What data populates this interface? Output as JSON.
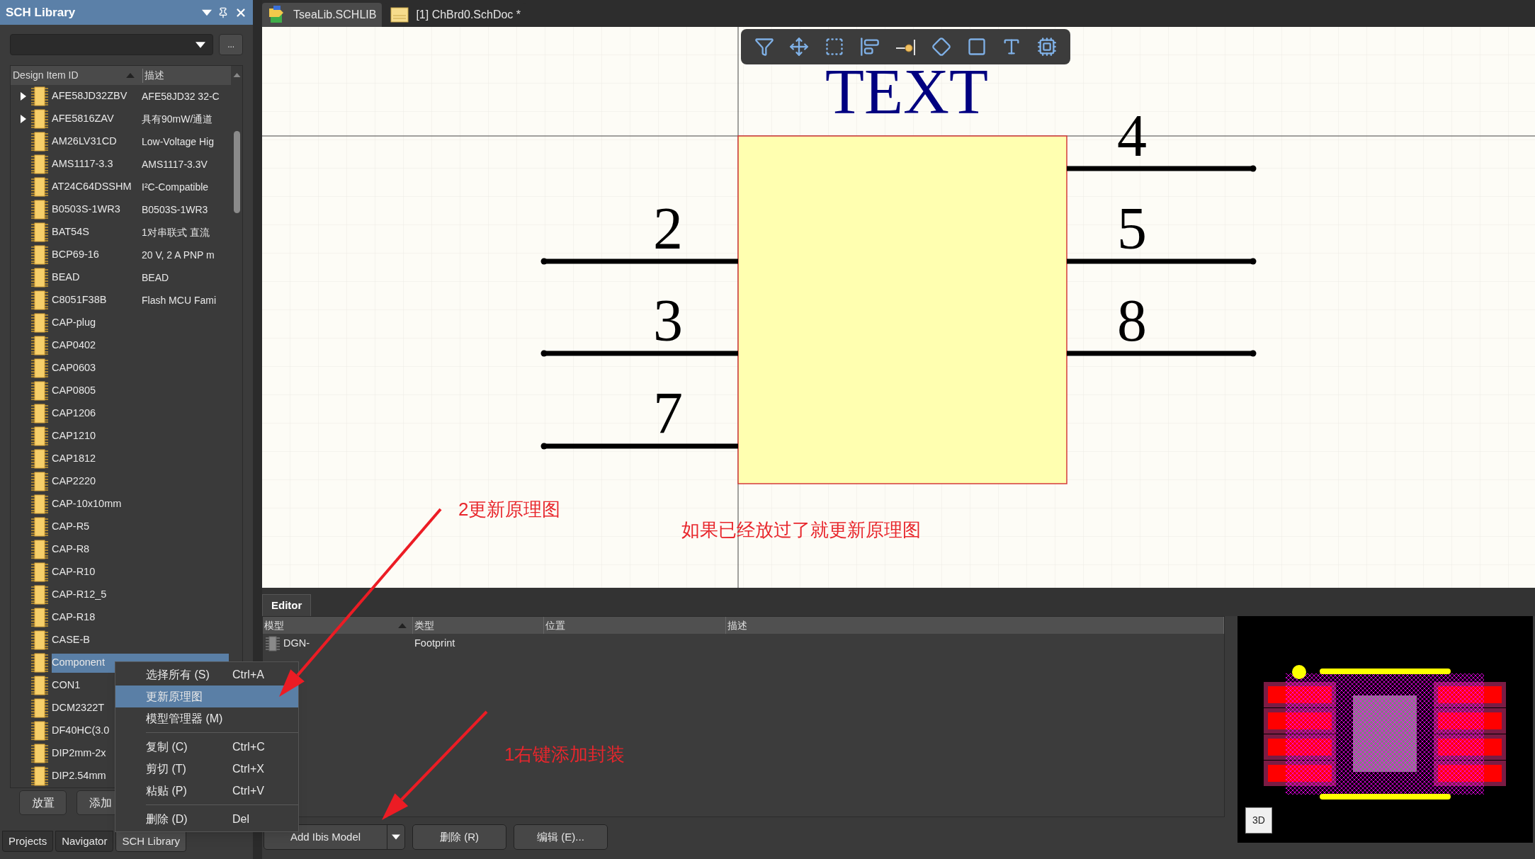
{
  "sidebar": {
    "title": "SCH Library",
    "browse_button": "...",
    "columns": [
      "Design Item ID",
      "描述"
    ],
    "items": [
      {
        "id": "AFE58JD32ZBV",
        "description": "AFE58JD32 32-C",
        "expandable": true,
        "selected": false
      },
      {
        "id": "AFE5816ZAV",
        "description": "具有90mW/通道",
        "expandable": true,
        "selected": false
      },
      {
        "id": "AM26LV31CD",
        "description": "Low-Voltage Hig",
        "expandable": false,
        "selected": false
      },
      {
        "id": "AMS1117-3.3",
        "description": "AMS1117-3.3V",
        "expandable": false,
        "selected": false
      },
      {
        "id": "AT24C64DSSHM",
        "description": "I²C-Compatible",
        "expandable": false,
        "selected": false
      },
      {
        "id": "B0503S-1WR3",
        "description": "B0503S-1WR3",
        "expandable": false,
        "selected": false
      },
      {
        "id": "BAT54S",
        "description": "1对串联式 直流",
        "expandable": false,
        "selected": false
      },
      {
        "id": "BCP69-16",
        "description": "20 V, 2 A PNP m",
        "expandable": false,
        "selected": false
      },
      {
        "id": "BEAD",
        "description": "BEAD",
        "expandable": false,
        "selected": false
      },
      {
        "id": "C8051F38B",
        "description": "Flash MCU Fami",
        "expandable": false,
        "selected": false
      },
      {
        "id": "CAP-plug",
        "expandable": false,
        "selected": false
      },
      {
        "id": "CAP0402",
        "expandable": false,
        "selected": false
      },
      {
        "id": "CAP0603",
        "expandable": false,
        "selected": false
      },
      {
        "id": "CAP0805",
        "expandable": false,
        "selected": false
      },
      {
        "id": "CAP1206",
        "expandable": false,
        "selected": false
      },
      {
        "id": "CAP1210",
        "expandable": false,
        "selected": false
      },
      {
        "id": "CAP1812",
        "expandable": false,
        "selected": false
      },
      {
        "id": "CAP2220",
        "expandable": false,
        "selected": false
      },
      {
        "id": "CAP-10x10mm",
        "expandable": false,
        "selected": false
      },
      {
        "id": "CAP-R5",
        "expandable": false,
        "selected": false
      },
      {
        "id": "CAP-R8",
        "expandable": false,
        "selected": false
      },
      {
        "id": "CAP-R10",
        "expandable": false,
        "selected": false
      },
      {
        "id": "CAP-R12_5",
        "expandable": false,
        "selected": false
      },
      {
        "id": "CAP-R18",
        "expandable": false,
        "selected": false
      },
      {
        "id": "CASE-B",
        "expandable": false,
        "selected": false
      },
      {
        "id": "Component",
        "expandable": false,
        "selected": true
      },
      {
        "id": "CON1",
        "expandable": false,
        "selected": false
      },
      {
        "id": "DCM2322T",
        "expandable": false,
        "selected": false
      },
      {
        "id": "DF40HC(3.0",
        "expandable": false,
        "selected": false
      },
      {
        "id": "DIP2mm-2x",
        "expandable": false,
        "selected": false
      },
      {
        "id": "DIP2.54mm",
        "expandable": false,
        "selected": false
      }
    ],
    "buttons": [
      "放置",
      "添加"
    ]
  },
  "panel_tabs": [
    {
      "label": "Projects",
      "selected": false
    },
    {
      "label": "Navigator",
      "selected": false
    },
    {
      "label": "SCH Library",
      "selected": true
    }
  ],
  "doc_tabs": [
    {
      "label": "TseaLib.SCHLIB",
      "kind": "library",
      "selected": true
    },
    {
      "label": "[1] ChBrd0.SchDoc *",
      "kind": "schematic",
      "selected": false
    }
  ],
  "canvas": {
    "title_text": "TEXT",
    "left_pins": [
      {
        "number": "2"
      },
      {
        "number": "3"
      },
      {
        "number": "7"
      }
    ],
    "right_pins": [
      {
        "number": "4"
      },
      {
        "number": "5"
      },
      {
        "number": "8"
      }
    ],
    "callout": "2更新原理图",
    "note": "如果已经放过了就更新原理图"
  },
  "context_menu": {
    "items": [
      {
        "kind": "item",
        "label": "选择所有 (S)",
        "shortcut": "Ctrl+A",
        "selected": false
      },
      {
        "kind": "item",
        "label": "更新原理图",
        "selected": true
      },
      {
        "kind": "item",
        "label": "模型管理器 (M)",
        "selected": false
      },
      {
        "kind": "separator"
      },
      {
        "kind": "item",
        "label": "复制 (C)",
        "shortcut": "Ctrl+C",
        "selected": false
      },
      {
        "kind": "item",
        "label": "剪切 (T)",
        "shortcut": "Ctrl+X",
        "selected": false
      },
      {
        "kind": "item",
        "label": "粘贴 (P)",
        "shortcut": "Ctrl+V",
        "selected": false
      },
      {
        "kind": "separator"
      },
      {
        "kind": "item",
        "label": "删除 (D)",
        "shortcut": "Del",
        "selected": false
      }
    ]
  },
  "editor": {
    "tab": "Editor",
    "columns": [
      "模型",
      "类型",
      "位置",
      "描述"
    ],
    "rows": [
      {
        "model": "DGN-",
        "type": "Footprint"
      }
    ],
    "buttons": [
      {
        "label": "Add Ibis Model",
        "kind": "split"
      },
      {
        "label": "删除 (R)",
        "kind": "plain"
      },
      {
        "label": "编辑 (E)...",
        "kind": "plain"
      }
    ],
    "callout": "1右键添加封装",
    "preview_button": "3D"
  }
}
